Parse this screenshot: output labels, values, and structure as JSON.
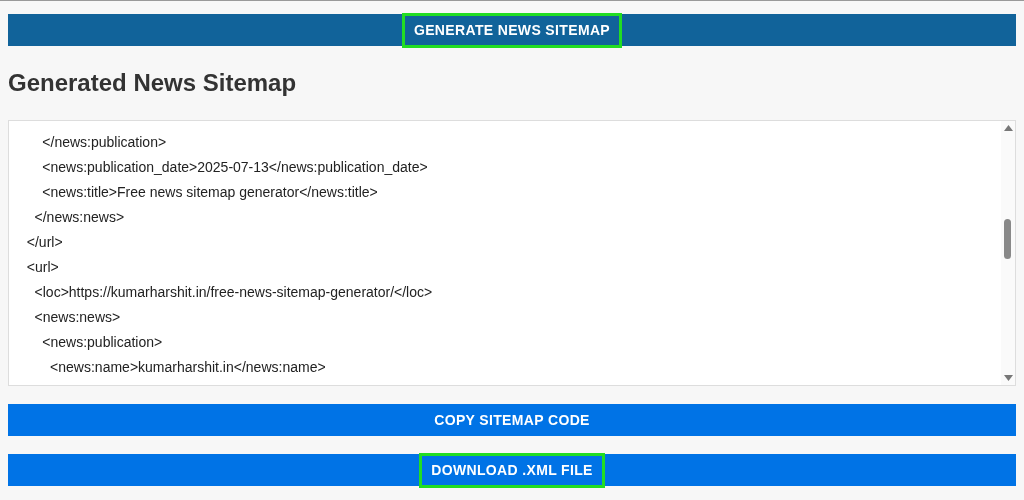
{
  "generate_button": {
    "label": "GENERATE NEWS SITEMAP",
    "highlighted": true
  },
  "heading": "Generated News Sitemap",
  "sitemap_code": {
    "lines": [
      "   </news:publication>",
      "   <news:publication_date>2025-07-13</news:publication_date>",
      "   <news:title>Free news sitemap generator</news:title>",
      "  </news:news>",
      " </url>",
      " <url>",
      "  <loc>https://kumarharshit.in/free-news-sitemap-generator/</loc>",
      "  <news:news>",
      "   <news:publication>",
      "    <news:name>kumarharshit.in</news:name>"
    ]
  },
  "action_buttons": [
    {
      "label": "COPY SITEMAP CODE",
      "highlighted": false
    },
    {
      "label": "DOWNLOAD .XML FILE",
      "highlighted": true
    }
  ]
}
